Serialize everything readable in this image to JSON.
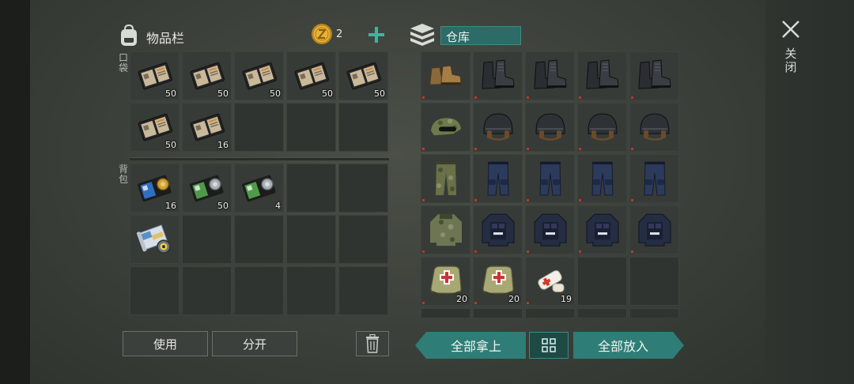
{
  "inventory": {
    "title": "物品栏",
    "coins": "2",
    "pocket_label": "口袋",
    "backpack_label": "背包",
    "use_label": "使用",
    "split_label": "分开",
    "pocket_slots": [
      {
        "item": "wallet-dark",
        "qty": "50"
      },
      {
        "item": "wallet-dark",
        "qty": "50"
      },
      {
        "item": "wallet-dark",
        "qty": "50"
      },
      {
        "item": "wallet-dark",
        "qty": "50"
      },
      {
        "item": "wallet-dark",
        "qty": "50"
      },
      {
        "item": "wallet-dark",
        "qty": "50"
      },
      {
        "item": "wallet-dark",
        "qty": "16"
      },
      {
        "item": "",
        "qty": ""
      },
      {
        "item": "",
        "qty": ""
      },
      {
        "item": "",
        "qty": ""
      }
    ],
    "backpack_slots": [
      {
        "item": "badge-gold",
        "qty": "16"
      },
      {
        "item": "badge-silver",
        "qty": "50"
      },
      {
        "item": "badge-silver",
        "qty": "4"
      },
      {
        "item": "",
        "qty": ""
      },
      {
        "item": "",
        "qty": ""
      },
      {
        "item": "map-scroll",
        "qty": ""
      },
      {
        "item": "",
        "qty": ""
      },
      {
        "item": "",
        "qty": ""
      },
      {
        "item": "",
        "qty": ""
      },
      {
        "item": "",
        "qty": ""
      },
      {
        "item": "",
        "qty": ""
      },
      {
        "item": "",
        "qty": ""
      },
      {
        "item": "",
        "qty": ""
      },
      {
        "item": "",
        "qty": ""
      },
      {
        "item": "",
        "qty": ""
      }
    ]
  },
  "warehouse": {
    "title": "仓库",
    "take_all_label": "全部拿上",
    "put_all_label": "全部放入",
    "slots": [
      {
        "item": "boots-brown",
        "qty": ""
      },
      {
        "item": "boots-black",
        "qty": ""
      },
      {
        "item": "boots-black",
        "qty": ""
      },
      {
        "item": "boots-black",
        "qty": ""
      },
      {
        "item": "boots-black",
        "qty": ""
      },
      {
        "item": "camo-cap",
        "qty": ""
      },
      {
        "item": "helmet",
        "qty": ""
      },
      {
        "item": "helmet",
        "qty": ""
      },
      {
        "item": "helmet",
        "qty": ""
      },
      {
        "item": "helmet",
        "qty": ""
      },
      {
        "item": "pants-camo",
        "qty": ""
      },
      {
        "item": "pants-navy",
        "qty": ""
      },
      {
        "item": "pants-navy",
        "qty": ""
      },
      {
        "item": "pants-navy",
        "qty": ""
      },
      {
        "item": "pants-navy",
        "qty": ""
      },
      {
        "item": "jacket-camo",
        "qty": ""
      },
      {
        "item": "vest-navy",
        "qty": ""
      },
      {
        "item": "vest-navy",
        "qty": ""
      },
      {
        "item": "vest-navy",
        "qty": ""
      },
      {
        "item": "vest-navy",
        "qty": ""
      },
      {
        "item": "medkit",
        "qty": "20"
      },
      {
        "item": "medkit",
        "qty": "20"
      },
      {
        "item": "bandage",
        "qty": "19"
      },
      {
        "item": "",
        "qty": ""
      },
      {
        "item": "",
        "qty": ""
      },
      {
        "item": "",
        "qty": ""
      },
      {
        "item": "",
        "qty": ""
      },
      {
        "item": "",
        "qty": ""
      },
      {
        "item": "",
        "qty": ""
      },
      {
        "item": "",
        "qty": ""
      }
    ]
  },
  "close_label": "关闭",
  "icons": {
    "backpack": "backpack-icon",
    "coin": "coin-icon",
    "add": "plus-icon",
    "warehouse": "stack-icon",
    "trash": "trash-icon",
    "grid": "grid-icon",
    "close": "close-icon"
  },
  "colors": {
    "accent": "#2e7d76",
    "plus": "#37b8a0",
    "coin": "#d9a62a"
  }
}
